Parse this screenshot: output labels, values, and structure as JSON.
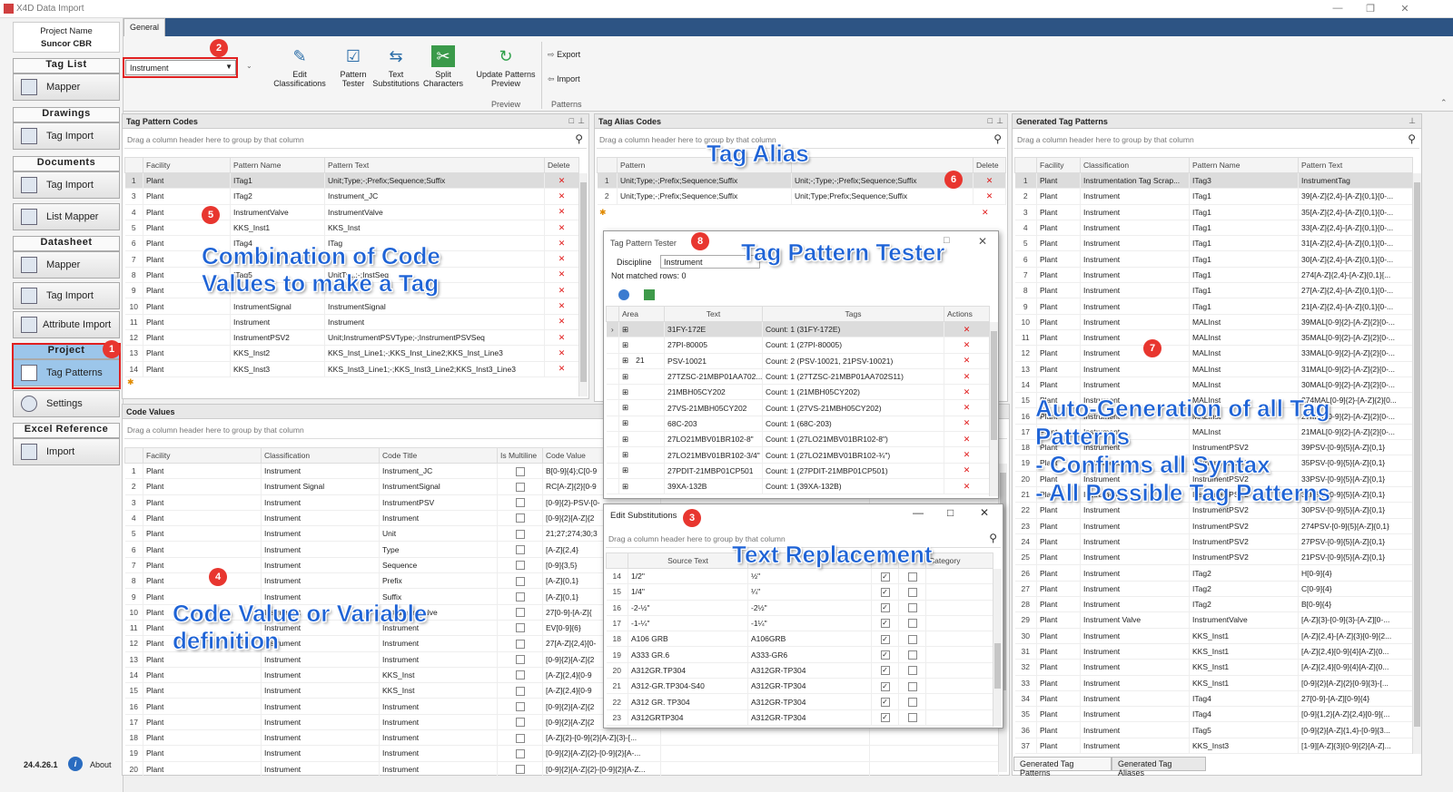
{
  "window": {
    "title": "X4D Data Import"
  },
  "sidebar": {
    "project_label": "Project Name",
    "project_value": "Suncor CBR",
    "sections": [
      {
        "title": "Tag List",
        "items": [
          {
            "label": "Mapper"
          }
        ]
      },
      {
        "title": "Drawings",
        "items": [
          {
            "label": "Tag Import"
          }
        ]
      },
      {
        "title": "Documents",
        "items": [
          {
            "label": "Tag Import"
          },
          {
            "label": "List Mapper"
          }
        ]
      },
      {
        "title": "Datasheet",
        "items": [
          {
            "label": "Mapper"
          },
          {
            "label": "Tag Import"
          },
          {
            "label": "Attribute Import"
          }
        ]
      },
      {
        "title": "Project",
        "items": [
          {
            "label": "Tag Patterns"
          },
          {
            "label": "Settings"
          }
        ]
      },
      {
        "title": "Excel Reference",
        "items": [
          {
            "label": "Import"
          }
        ]
      }
    ],
    "version": "24.4.26.1",
    "about": "About"
  },
  "ribbon": {
    "tab": "General",
    "discipline_value": "Instrument",
    "buttons": [
      "Edit Classifications",
      "Pattern Tester",
      "Text Substitutions",
      "Split Characters",
      "Update Patterns Preview"
    ],
    "preview_group": "Preview",
    "export": "Export",
    "import": "Import",
    "patterns_group": "Patterns"
  },
  "group_hint": "Drag a column header here to group by that column",
  "tag_pattern_codes": {
    "title": "Tag Pattern Codes",
    "columns": [
      "",
      "Facility",
      "Pattern Name",
      "Pattern Text",
      "Delete"
    ],
    "rows": [
      [
        "1",
        "Plant",
        "ITag1",
        "Unit;Type;-;Prefix;Sequence;Suffix"
      ],
      [
        "3",
        "Plant",
        "ITag2",
        "Instrument_JC"
      ],
      [
        "4",
        "Plant",
        "InstrumentValve",
        "InstrumentValve"
      ],
      [
        "5",
        "Plant",
        "KKS_Inst1",
        "KKS_Inst"
      ],
      [
        "6",
        "Plant",
        "ITag4",
        "ITag"
      ],
      [
        "7",
        "Plant",
        "",
        ""
      ],
      [
        "8",
        "Plant",
        "ITag5",
        "UnitTy...;-;InstSeq"
      ],
      [
        "9",
        "Plant",
        "",
        ""
      ],
      [
        "10",
        "Plant",
        "InstrumentSignal",
        "InstrumentSignal"
      ],
      [
        "11",
        "Plant",
        "Instrument",
        "Instrument"
      ],
      [
        "12",
        "Plant",
        "InstrumentPSV2",
        "Unit;InstrumentPSVType;-;InstrumentPSVSeq"
      ],
      [
        "13",
        "Plant",
        "KKS_Inst2",
        "KKS_Inst_Line1;-;KKS_Inst_Line2;KKS_Inst_Line3"
      ],
      [
        "14",
        "Plant",
        "KKS_Inst3",
        "KKS_Inst3_Line1;-;KKS_Inst3_Line2;KKS_Inst3_Line3"
      ]
    ]
  },
  "tag_alias_codes": {
    "title": "Tag Alias Codes",
    "columns": [
      "",
      "Pattern",
      "",
      "Delete"
    ],
    "rows": [
      [
        "1",
        "Unit;Type;-;Prefix;Sequence;Suffix",
        "Unit;-;Type;-;Prefix;Sequence;Suffix"
      ],
      [
        "2",
        "Unit;Type;-;Prefix;Sequence;Suffix",
        "Unit;Type;Prefix;Sequence;Suffix"
      ]
    ]
  },
  "tag_pattern_tester": {
    "title": "Tag Pattern Tester",
    "discipline_label": "Discipline",
    "discipline_value": "Instrument",
    "not_matched": "Not matched rows: 0",
    "columns": [
      "Area",
      "Text",
      "Tags",
      "Actions"
    ],
    "rows": [
      [
        "",
        "31FY-172E",
        "Count: 1 (31FY-172E)"
      ],
      [
        "",
        "27PI-80005",
        "Count: 1 (27PI-80005)"
      ],
      [
        "21",
        "PSV-10021",
        "Count: 2 (PSV-10021, 21PSV-10021)"
      ],
      [
        "",
        "27TZSC-21MBP01AA702...",
        "Count: 1 (27TZSC-21MBP01AA702S11)"
      ],
      [
        "",
        "21MBH05CY202",
        "Count: 1 (21MBH05CY202)"
      ],
      [
        "",
        "27VS-21MBH05CY202",
        "Count: 1 (27VS-21MBH05CY202)"
      ],
      [
        "",
        "68C-203",
        "Count: 1 (68C-203)"
      ],
      [
        "",
        "27LO21MBV01BR102-8\"",
        "Count: 1 (27LO21MBV01BR102-8\")"
      ],
      [
        "",
        "27LO21MBV01BR102-3/4\"",
        "Count: 1 (27LO21MBV01BR102-¾\")"
      ],
      [
        "",
        "27PDIT-21MBP01CP501",
        "Count: 1 (27PDIT-21MBP01CP501)"
      ],
      [
        "",
        "39XA-132B",
        "Count: 1 (39XA-132B)"
      ]
    ]
  },
  "edit_substitutions": {
    "title": "Edit Substitutions",
    "columns": [
      "",
      "Source Text",
      "",
      "",
      "",
      "Category"
    ],
    "rows": [
      [
        "14",
        "1/2\"",
        "½\""
      ],
      [
        "15",
        "1/4\"",
        "¼\""
      ],
      [
        "16",
        "-2-½\"",
        "-2½\""
      ],
      [
        "17",
        "-1-¼\"",
        "-1¼\""
      ],
      [
        "18",
        "A106 GRB",
        "A106GRB"
      ],
      [
        "19",
        "A333 GR.6",
        "A333-GR6"
      ],
      [
        "20",
        "A312GR.TP304",
        "A312GR-TP304"
      ],
      [
        "21",
        "A312-GR.TP304-S40",
        "A312GR-TP304"
      ],
      [
        "22",
        "A312 GR. TP304",
        "A312GR-TP304"
      ],
      [
        "23",
        "A312GRTP304",
        "A312GR-TP304"
      ]
    ]
  },
  "code_values": {
    "title": "Code Values",
    "columns": [
      "",
      "Facility",
      "Classification",
      "Code Title",
      "Is Multiline",
      "Code Value"
    ],
    "rows": [
      [
        "1",
        "Plant",
        "Instrument",
        "Instrument_JC",
        "B[0-9]{4};C[0-9"
      ],
      [
        "2",
        "Plant",
        "Instrument Signal",
        "InstrumentSignal",
        "RC[A-Z]{2}[0-9"
      ],
      [
        "3",
        "Plant",
        "Instrument",
        "InstrumentPSV",
        "[0-9]{2}-PSV-[0-"
      ],
      [
        "4",
        "Plant",
        "Instrument",
        "Instrument",
        "[0-9]{2}[A-Z]{2"
      ],
      [
        "5",
        "Plant",
        "Instrument",
        "Unit",
        "21;27;274;30;3"
      ],
      [
        "6",
        "Plant",
        "Instrument",
        "Type",
        "[A-Z]{2,4}"
      ],
      [
        "7",
        "Plant",
        "Instrument",
        "Sequence",
        "[0-9]{3,5}"
      ],
      [
        "8",
        "Plant",
        "Instrument",
        "Prefix",
        "[A-Z]{0,1}"
      ],
      [
        "9",
        "Plant",
        "Instrument",
        "Suffix",
        "[A-Z]{0,1}"
      ],
      [
        "10",
        "Plant",
        "Instrument",
        "InstrumentValve",
        "27[0-9]-[A-Z]{"
      ],
      [
        "11",
        "Plant",
        "Instrument",
        "Instrument",
        "EV[0-9]{6}"
      ],
      [
        "12",
        "Plant",
        "Instrument",
        "Instrument",
        "27[A-Z]{2,4}[0-"
      ],
      [
        "13",
        "Plant",
        "Instrument",
        "Instrument",
        "[0-9]{2}[A-Z]{2"
      ],
      [
        "14",
        "Plant",
        "Instrument",
        "KKS_Inst",
        "[A-Z]{2,4}[0-9"
      ],
      [
        "15",
        "Plant",
        "Instrument",
        "KKS_Inst",
        "[A-Z]{2,4}[0-9"
      ],
      [
        "16",
        "Plant",
        "Instrument",
        "Instrument",
        "[0-9]{2}[A-Z]{2"
      ],
      [
        "17",
        "Plant",
        "Instrument",
        "Instrument",
        "[0-9]{2}[A-Z]{2"
      ],
      [
        "18",
        "Plant",
        "Instrument",
        "Instrument",
        "[A-Z]{2}-[0-9]{2}[A-Z]{3}-[..."
      ],
      [
        "19",
        "Plant",
        "Instrument",
        "Instrument",
        "[0-9]{2}[A-Z]{2}-[0-9]{2}[A-..."
      ],
      [
        "20",
        "Plant",
        "Instrument",
        "Instrument",
        "[0-9]{2}[A-Z]{2}-[0-9]{2}[A-Z..."
      ]
    ]
  },
  "generated_tag_patterns": {
    "title": "Generated Tag Patterns",
    "columns": [
      "",
      "Facility",
      "Classification",
      "Pattern Name",
      "Pattern Text"
    ],
    "rows": [
      [
        "1",
        "Plant",
        "Instrumentation Tag Scrap...",
        "ITag3",
        "InstrumentTag"
      ],
      [
        "2",
        "Plant",
        "Instrument",
        "ITag1",
        "39[A-Z]{2,4}-[A-Z]{0,1}[0-..."
      ],
      [
        "3",
        "Plant",
        "Instrument",
        "ITag1",
        "35[A-Z]{2,4}-[A-Z]{0,1}[0-..."
      ],
      [
        "4",
        "Plant",
        "Instrument",
        "ITag1",
        "33[A-Z]{2,4}-[A-Z]{0,1}[0-..."
      ],
      [
        "5",
        "Plant",
        "Instrument",
        "ITag1",
        "31[A-Z]{2,4}-[A-Z]{0,1}[0-..."
      ],
      [
        "6",
        "Plant",
        "Instrument",
        "ITag1",
        "30[A-Z]{2,4}-[A-Z]{0,1}[0-..."
      ],
      [
        "7",
        "Plant",
        "Instrument",
        "ITag1",
        "274[A-Z]{2,4}-[A-Z]{0,1}[..."
      ],
      [
        "8",
        "Plant",
        "Instrument",
        "ITag1",
        "27[A-Z]{2,4}-[A-Z]{0,1}[0-..."
      ],
      [
        "9",
        "Plant",
        "Instrument",
        "ITag1",
        "21[A-Z]{2,4}-[A-Z]{0,1}[0-..."
      ],
      [
        "10",
        "Plant",
        "Instrument",
        "MALInst",
        "39MAL[0-9]{2}-[A-Z]{2}[0-..."
      ],
      [
        "11",
        "Plant",
        "Instrument",
        "MALInst",
        "35MAL[0-9]{2}-[A-Z]{2}[0-..."
      ],
      [
        "12",
        "Plant",
        "Instrument",
        "MALInst",
        "33MAL[0-9]{2}-[A-Z]{2}[0-..."
      ],
      [
        "13",
        "Plant",
        "Instrument",
        "MALInst",
        "31MAL[0-9]{2}-[A-Z]{2}[0-..."
      ],
      [
        "14",
        "Plant",
        "Instrument",
        "MALInst",
        "30MAL[0-9]{2}-[A-Z]{2}[0-..."
      ],
      [
        "15",
        "Plant",
        "Instrument",
        "MALInst",
        "274MAL[0-9]{2}-[A-Z]{2}[0..."
      ],
      [
        "16",
        "Plant",
        "Instrument",
        "MALInst",
        "27MAL[0-9]{2}-[A-Z]{2}[0-..."
      ],
      [
        "17",
        "Plant",
        "Instrument",
        "MALInst",
        "21MAL[0-9]{2}-[A-Z]{2}[0-..."
      ],
      [
        "18",
        "Plant",
        "Instrument",
        "InstrumentPSV2",
        "39PSV-[0-9]{5}[A-Z]{0,1}"
      ],
      [
        "19",
        "Plant",
        "Instrument",
        "InstrumentPSV2",
        "35PSV-[0-9]{5}[A-Z]{0,1}"
      ],
      [
        "20",
        "Plant",
        "Instrument",
        "InstrumentPSV2",
        "33PSV-[0-9]{5}[A-Z]{0,1}"
      ],
      [
        "21",
        "Plant",
        "Instrument",
        "InstrumentPSV2",
        "31PSV-[0-9]{5}[A-Z]{0,1}"
      ],
      [
        "22",
        "Plant",
        "Instrument",
        "InstrumentPSV2",
        "30PSV-[0-9]{5}[A-Z]{0,1}"
      ],
      [
        "23",
        "Plant",
        "Instrument",
        "InstrumentPSV2",
        "274PSV-[0-9]{5}[A-Z]{0,1}"
      ],
      [
        "24",
        "Plant",
        "Instrument",
        "InstrumentPSV2",
        "27PSV-[0-9]{5}[A-Z]{0,1}"
      ],
      [
        "25",
        "Plant",
        "Instrument",
        "InstrumentPSV2",
        "21PSV-[0-9]{5}[A-Z]{0,1}"
      ],
      [
        "26",
        "Plant",
        "Instrument",
        "ITag2",
        "H[0-9]{4}"
      ],
      [
        "27",
        "Plant",
        "Instrument",
        "ITag2",
        "C[0-9]{4}"
      ],
      [
        "28",
        "Plant",
        "Instrument",
        "ITag2",
        "B[0-9]{4}"
      ],
      [
        "29",
        "Plant",
        "Instrument Valve",
        "InstrumentValve",
        "[A-Z]{3}-[0-9]{3}-[A-Z][0-..."
      ],
      [
        "30",
        "Plant",
        "Instrument",
        "KKS_Inst1",
        "[A-Z]{2,4}-[A-Z]{3}[0-9]{2..."
      ],
      [
        "31",
        "Plant",
        "Instrument",
        "KKS_Inst1",
        "[A-Z]{2,4}[0-9]{4}[A-Z]{0..."
      ],
      [
        "32",
        "Plant",
        "Instrument",
        "KKS_Inst1",
        "[A-Z]{2,4}[0-9]{4}[A-Z]{0..."
      ],
      [
        "33",
        "Plant",
        "Instrument",
        "KKS_Inst1",
        "[0-9]{2}[A-Z]{2}[0-9]{3}-[..."
      ],
      [
        "34",
        "Plant",
        "Instrument",
        "ITag4",
        "27[0-9]-[A-Z][0-9]{4}"
      ],
      [
        "35",
        "Plant",
        "Instrument",
        "ITag4",
        "[0-9]{1,2}[A-Z]{2,4}[0-9]{..."
      ],
      [
        "36",
        "Plant",
        "Instrument",
        "ITag5",
        "[0-9]{2}[A-Z]{1,4}-[0-9]{3..."
      ],
      [
        "37",
        "Plant",
        "Instrument",
        "KKS_Inst3",
        "[1-9][A-Z]{3}[0-9]{2}[A-Z]..."
      ]
    ],
    "tabs": [
      "Generated Tag Patterns",
      "Generated Tag Aliases"
    ]
  },
  "annotations": {
    "tag_alias": "Tag Alias",
    "tag_pattern_tester": "Tag Pattern Tester",
    "combination_l1": "Combination of Code",
    "combination_l2": "Values to make a Tag",
    "code_value_l1": "Code Value or Variable",
    "code_value_l2": "definition",
    "text_replacement": "Text Replacement",
    "auto_l1": "Auto-Generation of all Tag",
    "auto_l2": "Patterns",
    "auto_l3": "- Confirms all Syntax",
    "auto_l4": "- All Possible Tag Patterns"
  },
  "badges": [
    "1",
    "2",
    "3",
    "4",
    "5",
    "6",
    "7",
    "8"
  ],
  "colors": {
    "ribbon_bar": "#2d5484",
    "highlight": "#e02020",
    "callout": "#1e63d6",
    "badge": "#e8362f",
    "delete": "#e01818"
  }
}
